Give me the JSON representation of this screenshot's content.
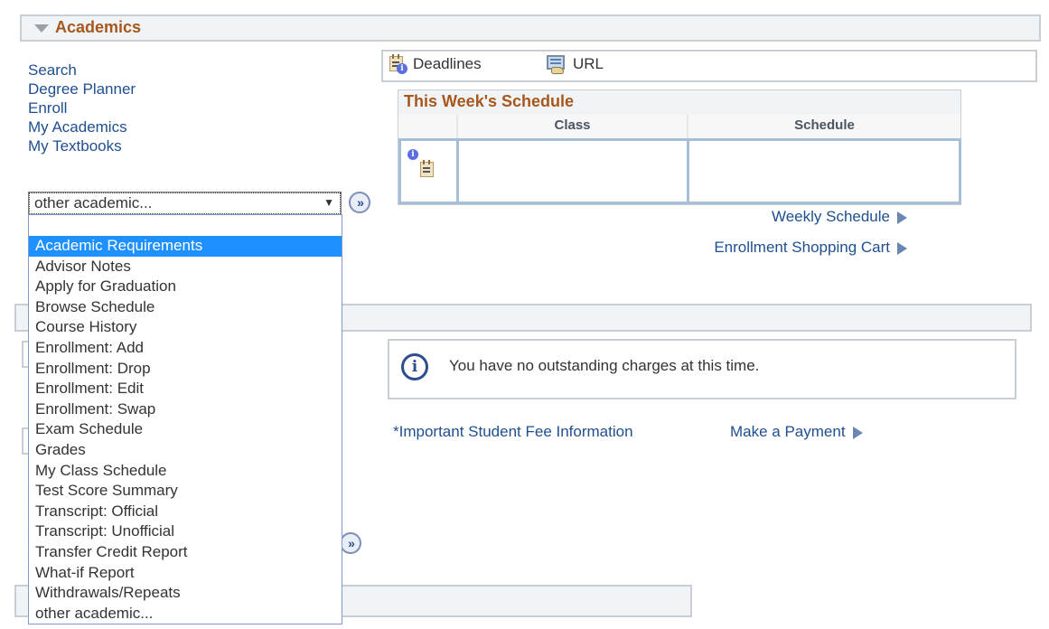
{
  "academics": {
    "title": "Academics",
    "links": [
      "Search",
      "Degree Planner",
      "Enroll",
      "My Academics",
      "My Textbooks"
    ],
    "toolbar": {
      "deadlines_label": "Deadlines",
      "url_label": "URL"
    },
    "other_select": {
      "selected_value": "other academic...",
      "highlighted_option": "Academic Requirements",
      "options": [
        "",
        "Academic Requirements",
        "Advisor Notes",
        "Apply for Graduation",
        "Browse Schedule",
        "Course History",
        "Enrollment: Add",
        "Enrollment: Drop",
        "Enrollment: Edit",
        "Enrollment: Swap",
        "Exam Schedule",
        "Grades",
        "My Class Schedule",
        "Test Score Summary",
        "Transcript: Official",
        "Transcript: Unofficial",
        "Transfer Credit Report",
        "What-if Report",
        "Withdrawals/Repeats",
        "other academic..."
      ]
    },
    "go_button_label": "»",
    "schedule": {
      "title": "This Week's Schedule",
      "columns": [
        "",
        "Class",
        "Schedule"
      ],
      "rows": [
        [
          "",
          "",
          ""
        ]
      ]
    },
    "weekly_schedule_link": "Weekly Schedule",
    "shopping_cart_link": "Enrollment Shopping Cart"
  },
  "finances": {
    "message": "You have no outstanding charges at this time.",
    "fee_info_link": "*Important Student Fee Information",
    "payment_link": "Make a Payment",
    "go_button_label": "»"
  },
  "icons": {
    "info_glyph": "i"
  }
}
